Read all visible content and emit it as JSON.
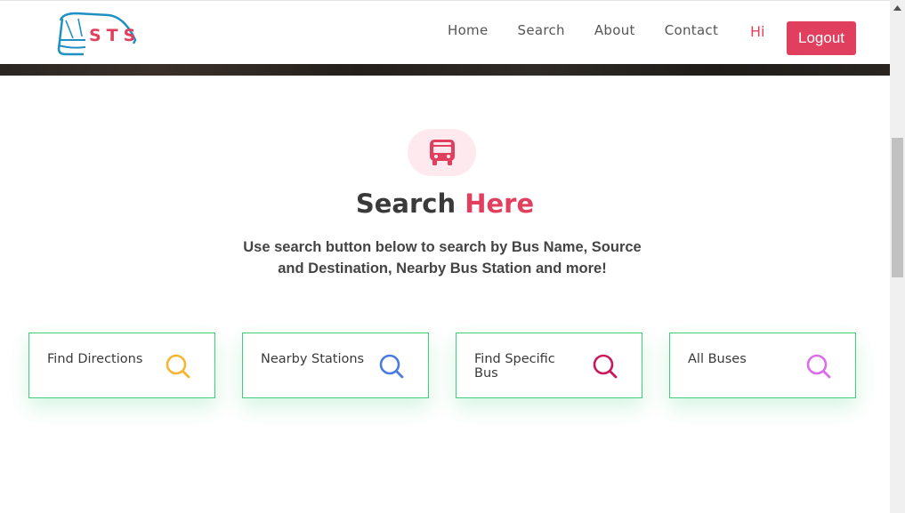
{
  "brand": {
    "logo_text": "STS",
    "accent_color": "#e0405e",
    "logo_blue": "#1f8fc4"
  },
  "nav": {
    "links": [
      "Home",
      "Search",
      "About",
      "Contact"
    ],
    "greeting": "Hi",
    "logout_label": "Logout"
  },
  "search_section": {
    "icon": "bus-icon",
    "title_main": "Search",
    "title_accent": "Here",
    "description": "Use search button below to search by Bus Name, Source and Destination, Nearby Bus Station and more!"
  },
  "cards": [
    {
      "label": "Find Directions",
      "icon": "search-icon",
      "icon_color": "#f5b731"
    },
    {
      "label": "Nearby Stations",
      "icon": "search-icon",
      "icon_color": "#4a7be0"
    },
    {
      "label": "Find Specific Bus",
      "icon": "search-icon",
      "icon_color": "#c9185b"
    },
    {
      "label": "All Buses",
      "icon": "search-icon",
      "icon_color": "#d96ee8"
    }
  ],
  "card_border_color": "#3ecf7a"
}
